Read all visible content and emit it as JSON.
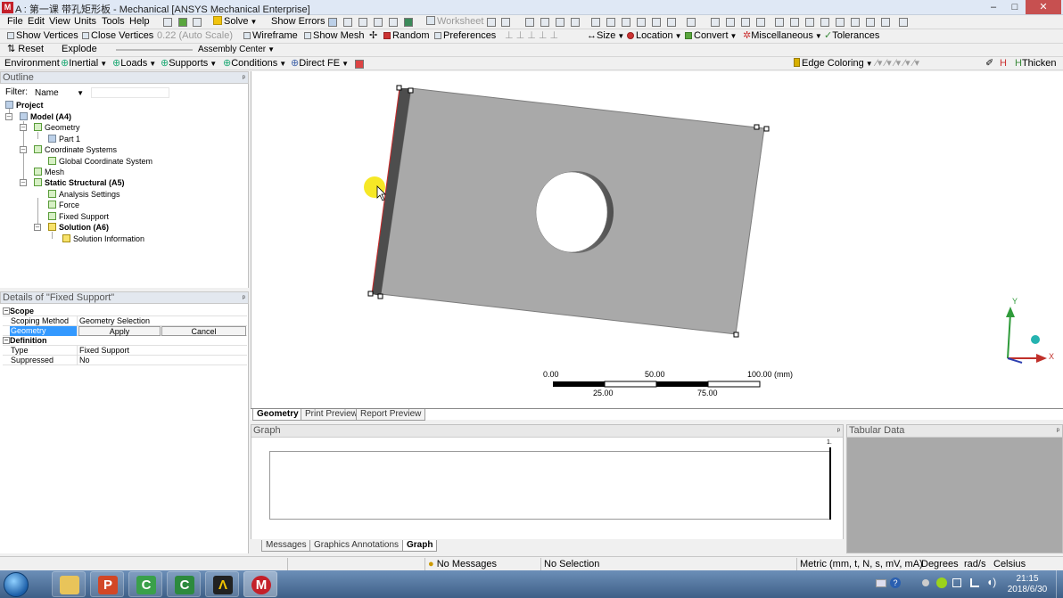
{
  "window": {
    "logo": "M",
    "title": "A : 第一课 带孔矩形板 - Mechanical [ANSYS Mechanical Enterprise]",
    "min": "–",
    "max": "□",
    "close": "✕"
  },
  "menu": [
    "File",
    "Edit",
    "View",
    "Units",
    "Tools",
    "Help"
  ],
  "toolbar1": {
    "solve": "Solve",
    "show_errors": "Show Errors",
    "worksheet": "Worksheet"
  },
  "toolbar2": {
    "show_vertices": "Show Vertices",
    "close_vertices": "Close Vertices",
    "scale": "0.22 (Auto Scale)",
    "wireframe": "Wireframe",
    "show_mesh": "Show Mesh",
    "random": "Random",
    "preferences": "Preferences",
    "size": "Size",
    "location": "Location",
    "convert": "Convert",
    "misc": "Miscellaneous",
    "tolerances": "Tolerances"
  },
  "toolbar3": {
    "reset": "Reset",
    "explode": "Explode",
    "assembly_center": "Assembly Center"
  },
  "context_toolbar": {
    "environment": "Environment",
    "inertial": "Inertial",
    "loads": "Loads",
    "supports": "Supports",
    "conditions": "Conditions",
    "direct_fe": "Direct FE",
    "edge_coloring": "Edge Coloring",
    "thicken": "Thicken"
  },
  "outline": {
    "header": "Outline",
    "pin": "ᵖ",
    "filter_label": "Filter:",
    "filter_value": "Name",
    "tree": [
      "Project",
      "Model (A4)",
      "Geometry",
      "Part 1",
      "Coordinate Systems",
      "Global Coordinate System",
      "Mesh",
      "Static Structural (A5)",
      "Analysis Settings",
      "Force",
      "Fixed Support",
      "Solution (A6)",
      "Solution Information"
    ]
  },
  "details": {
    "header": "Details of \"Fixed Support\"",
    "scope": "Scope",
    "scoping_method_key": "Scoping Method",
    "scoping_method_val": "Geometry Selection",
    "geometry_key": "Geometry",
    "apply": "Apply",
    "cancel": "Cancel",
    "definition": "Definition",
    "type_key": "Type",
    "type_val": "Fixed Support",
    "suppressed_key": "Suppressed",
    "suppressed_val": "No"
  },
  "viewport": {
    "scale": {
      "t0": "0.00",
      "t50": "50.00",
      "t100": "100.00 (mm)",
      "t25": "25.00",
      "t75": "75.00"
    },
    "axis_y": "Y",
    "axis_x": "X"
  },
  "view_tabs": [
    "Geometry",
    "Print Preview",
    "Report Preview"
  ],
  "graph": {
    "header": "Graph",
    "tick": "1."
  },
  "tabular": {
    "header": "Tabular Data"
  },
  "bottom_tabs": [
    "Messages",
    "Graphics Annotations",
    "Graph"
  ],
  "status": {
    "messages": "No Messages",
    "selection": "No Selection",
    "units": "Metric (mm, t, N, s, mV, mA)",
    "angle": "Degrees",
    "rate": "rad/s",
    "temp": "Celsius"
  },
  "clock": {
    "time": "21:15",
    "date": "2018/6/30"
  }
}
